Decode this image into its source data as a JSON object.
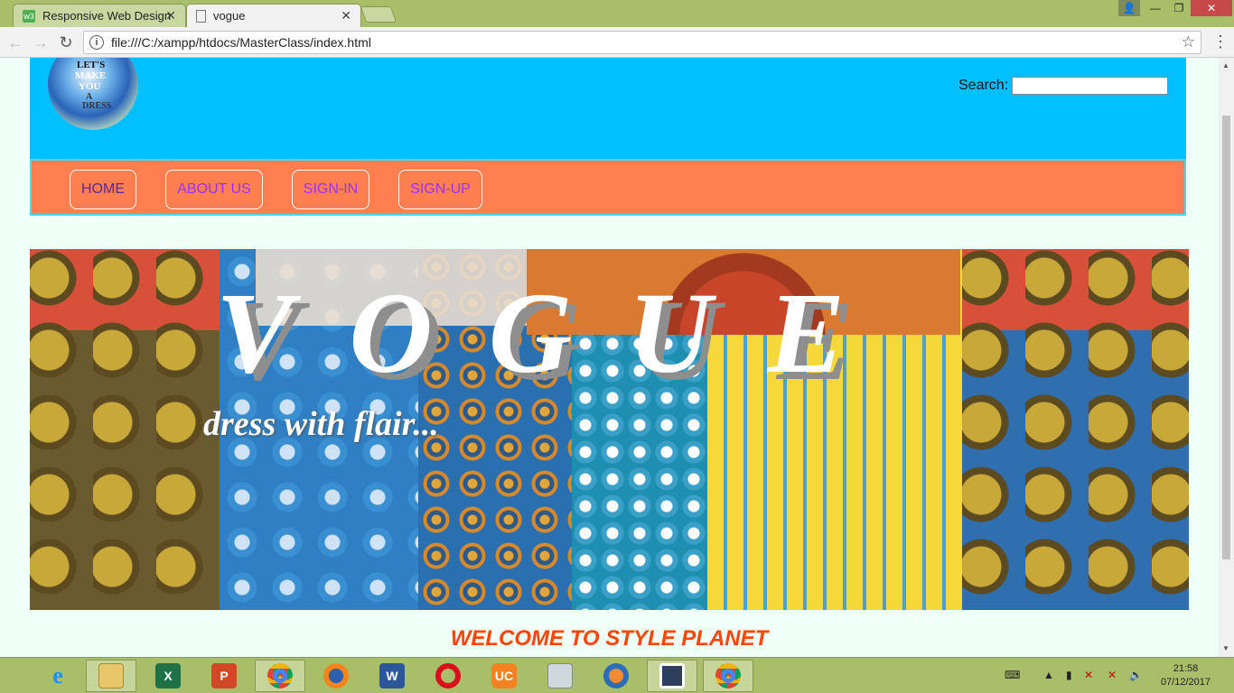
{
  "browser": {
    "tabs": [
      {
        "label": "Responsive Web Design"
      },
      {
        "label": "vogue"
      }
    ],
    "address": "file:///C:/xampp/htdocs/MasterClass/index.html"
  },
  "site": {
    "search_label": "Search:",
    "nav": [
      {
        "label": "HOME"
      },
      {
        "label": "ABOUT US"
      },
      {
        "label": "SIGN-IN"
      },
      {
        "label": "SIGN-UP"
      }
    ],
    "hero_title": "VOGUE",
    "hero_subtitle": "dress with flair...",
    "welcome": "WELCOME TO STYLE PLANET",
    "logo_text": "LET'S MAKE YOU A DRESS"
  },
  "taskbar": {
    "time": "21:58",
    "date": "07/12/2017",
    "apps": [
      "internet-explorer",
      "file-explorer",
      "excel",
      "powerpoint",
      "chrome",
      "firefox",
      "word",
      "opera",
      "uc-browser",
      "performance-monitor",
      "firefox-developer",
      "app-launcher",
      "chrome"
    ]
  },
  "colors": {
    "header_bg": "#00bfff",
    "nav_bg": "#ff7f50",
    "nav_text": "#9b30ff",
    "welcome": "#ff4500",
    "page_bg": "#eefff8"
  }
}
